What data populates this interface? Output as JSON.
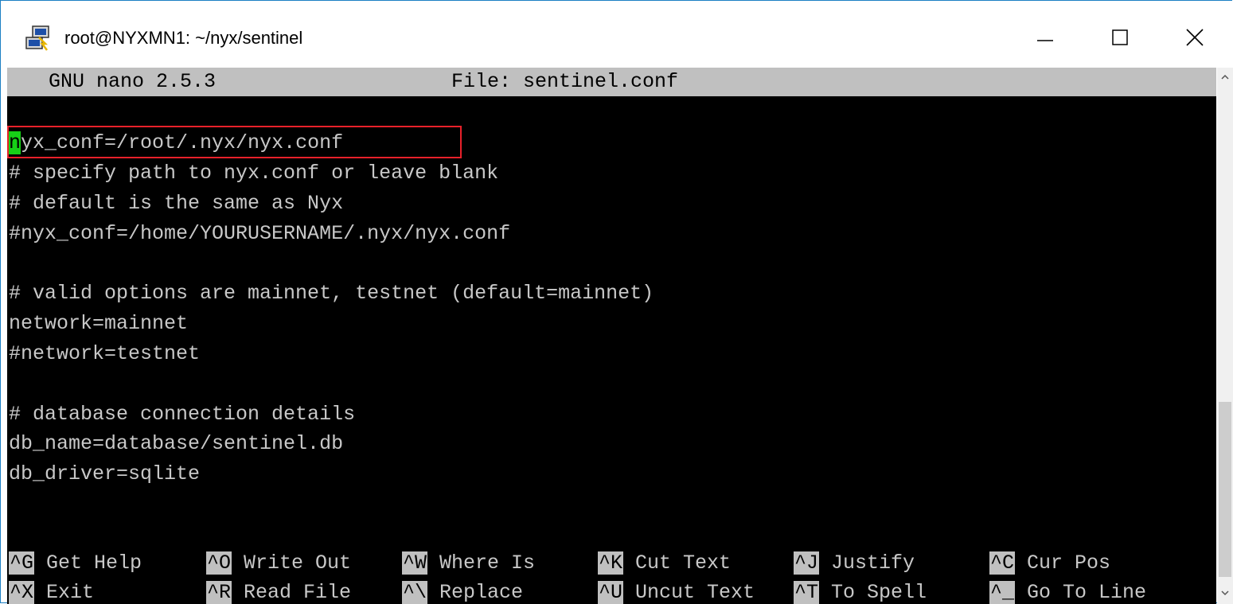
{
  "window": {
    "title": "root@NYXMN1: ~/nyx/sentinel",
    "icon": "putty-icon"
  },
  "nano": {
    "version": "GNU nano 2.5.3",
    "file_label": "File: sentinel.conf"
  },
  "editor": {
    "cursor_char": "n",
    "line1_rest": "yx_conf=/root/.nyx/nyx.conf",
    "lines": [
      "# specify path to nyx.conf or leave blank",
      "# default is the same as Nyx",
      "#nyx_conf=/home/YOURUSERNAME/.nyx/nyx.conf",
      "",
      "# valid options are mainnet, testnet (default=mainnet)",
      "network=mainnet",
      "#network=testnet",
      "",
      "# database connection details",
      "db_name=database/sentinel.db",
      "db_driver=sqlite"
    ]
  },
  "shortcuts": {
    "row1": [
      {
        "key": "^G",
        "label": "Get Help"
      },
      {
        "key": "^O",
        "label": "Write Out"
      },
      {
        "key": "^W",
        "label": "Where Is"
      },
      {
        "key": "^K",
        "label": "Cut Text"
      },
      {
        "key": "^J",
        "label": "Justify"
      },
      {
        "key": "^C",
        "label": "Cur Pos"
      }
    ],
    "row2": [
      {
        "key": "^X",
        "label": "Exit"
      },
      {
        "key": "^R",
        "label": "Read File"
      },
      {
        "key": "^\\",
        "label": "Replace"
      },
      {
        "key": "^U",
        "label": "Uncut Text"
      },
      {
        "key": "^T",
        "label": "To Spell"
      },
      {
        "key": "^_",
        "label": "Go To Line"
      }
    ]
  },
  "colors": {
    "cursor": "#17d017",
    "highlight_box": "#e8212a",
    "terminal_bg": "#000000",
    "header_bg": "#c0c0c0"
  }
}
